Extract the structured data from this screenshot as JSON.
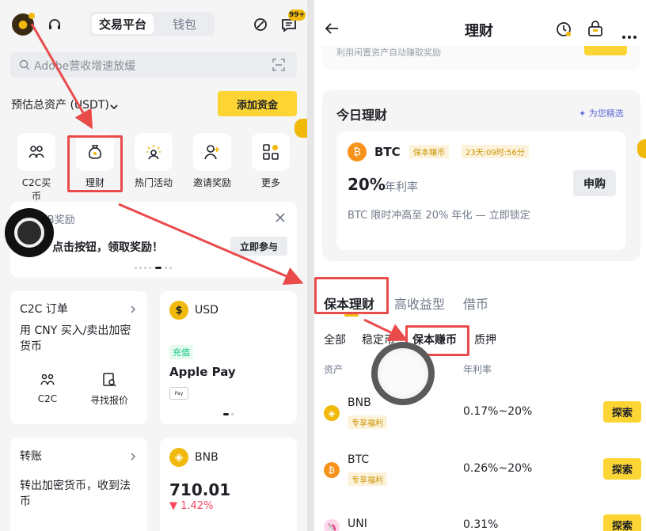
{
  "left": {
    "top_tabs": [
      "交易平台",
      "钱包"
    ],
    "badge": "99+",
    "search_placeholder": "Adobe营收增速放缓",
    "assets_label": "预估总资产 (USDT)",
    "add_funds": "添加资金",
    "quick": [
      "C2C买币",
      "理财",
      "热门活动",
      "邀请奖励",
      "更多"
    ],
    "promo_title": "NB奖励",
    "promo_text": "点击按钮，领取奖励！",
    "promo_btn": "立即参与",
    "c2c_title": "C2C 订单",
    "c2c_desc": "用 CNY 买入/卖出加密货币",
    "c2c_a": "C2C",
    "c2c_b": "寻找报价",
    "usd_title": "USD",
    "usd_tag": "充值",
    "usd_pay": "Apple Pay",
    "usd_paylogo": "Pay",
    "transfer_title": "转账",
    "transfer_desc": "转出加密货币，收到法币",
    "bnb_name": "BNB",
    "bnb_price": "710.01",
    "bnb_change": "▼ 1.42%",
    "bnb_icon_char": "◈"
  },
  "right": {
    "back": "←",
    "title": "理财",
    "top_text": "利用闲置资产自动赚取奖励",
    "today_title": "今日理财",
    "pick": "✦ 为您精选",
    "btc_name": "BTC",
    "btc_tag": "保本赚币",
    "btc_timer": "23天:09时:56分",
    "apr": "20%",
    "apr_label": "年利率",
    "buy": "申购",
    "btc_desc": "BTC 限时冲高至 20% 年化 — 立即锁定",
    "tabs": [
      "保本理财",
      "高收益型",
      "借币"
    ],
    "subtabs": [
      "全部",
      "稳定币",
      "保本赚币",
      "质押"
    ],
    "col_asset": "资产",
    "col_apr": "年利率",
    "rows": [
      {
        "name": "BNB",
        "tag": "专享福利",
        "apr": "0.17%~20%",
        "btn": "探索",
        "color": "#f0b90b",
        "char": "◈"
      },
      {
        "name": "BTC",
        "tag": "专享福利",
        "apr": "0.26%~20%",
        "btn": "探索",
        "color": "#f7931a",
        "char": "₿"
      },
      {
        "name": "UNI",
        "tag": "",
        "apr": "0.31%",
        "btn": "探索",
        "color": "#ff007a",
        "char": "🦄"
      }
    ],
    "btc_char": "₿"
  },
  "colors": {
    "brand": "#fcd535",
    "arrow": "#e94b4b"
  }
}
